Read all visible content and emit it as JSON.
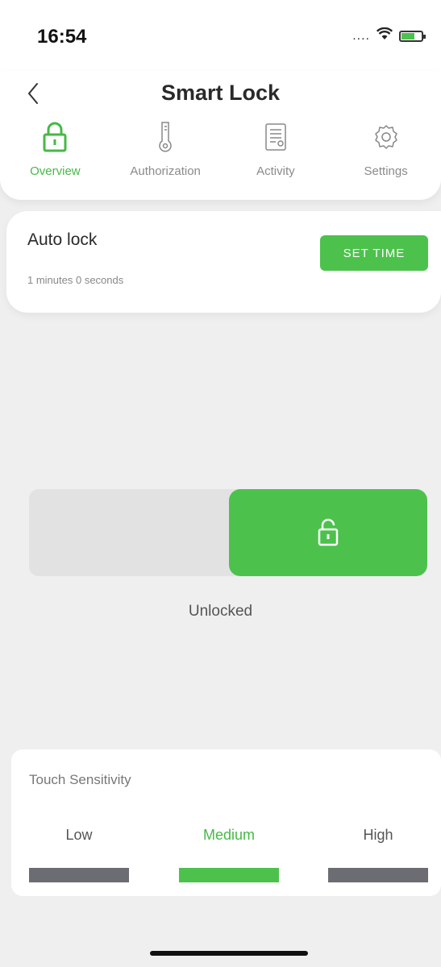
{
  "status_bar": {
    "time": "16:54",
    "signal": "....",
    "wifi_icon": "wifi-icon",
    "battery_icon": "battery-charging-icon"
  },
  "header": {
    "title": "Smart Lock",
    "back_icon": "chevron-left-icon",
    "tabs": [
      {
        "label": "Overview",
        "icon": "lock-icon",
        "active": true
      },
      {
        "label": "Authorization",
        "icon": "key-icon",
        "active": false
      },
      {
        "label": "Activity",
        "icon": "log-icon",
        "active": false
      },
      {
        "label": "Settings",
        "icon": "gear-icon",
        "active": false
      }
    ]
  },
  "auto_lock": {
    "title": "Auto lock",
    "subtitle": "1 minutes 0 seconds",
    "button_label": "SET TIME"
  },
  "lock_control": {
    "status": "Unlocked",
    "icon": "unlocked-padlock-icon"
  },
  "touch_sensitivity": {
    "title": "Touch Sensitivity",
    "options": [
      {
        "label": "Low",
        "selected": false
      },
      {
        "label": "Medium",
        "selected": true
      },
      {
        "label": "High",
        "selected": false
      }
    ]
  },
  "colors": {
    "accent": "#4cc24c",
    "inactive_bar": "#6b6d72",
    "background": "#efefef"
  }
}
